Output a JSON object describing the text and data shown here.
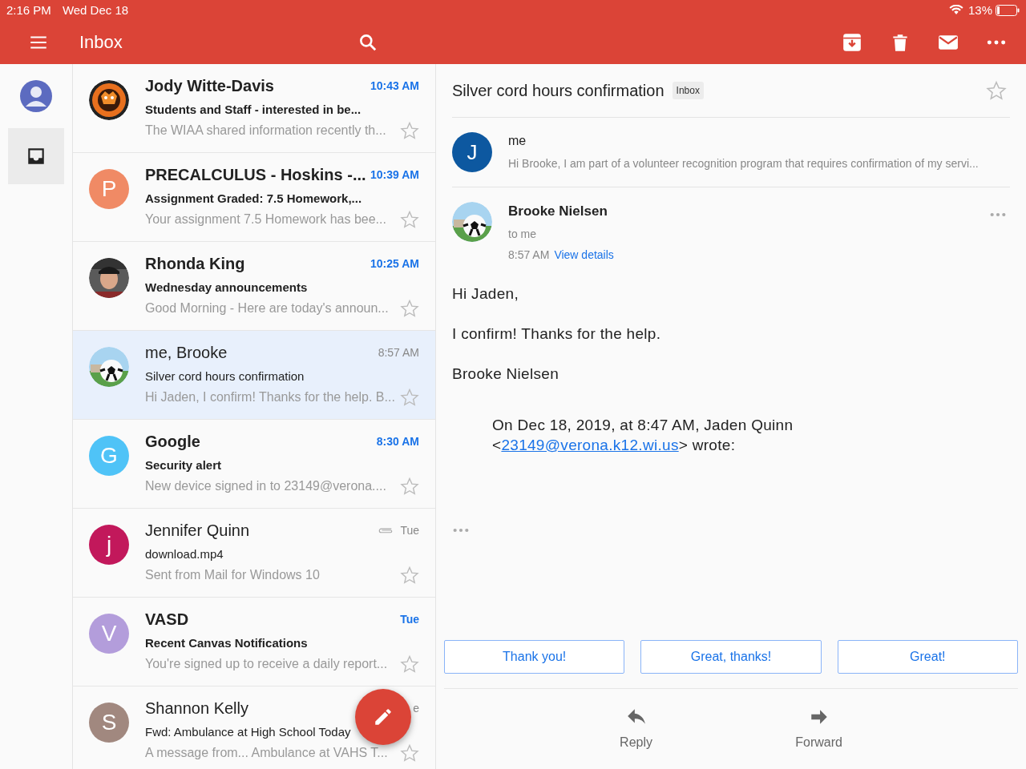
{
  "status_bar": {
    "time": "2:16 PM",
    "date": "Wed Dec 18",
    "battery": "13%"
  },
  "toolbar": {
    "title": "Inbox"
  },
  "rail": [
    {
      "kind": "account",
      "selected": false
    },
    {
      "kind": "inbox",
      "selected": true
    }
  ],
  "messages": [
    {
      "sender": "Jody Witte-Davis",
      "subject": "Students and Staff - interested in be...",
      "snippet": "The WIAA shared information recently th...",
      "time": "10:43 AM",
      "unread": true,
      "selected": false,
      "attachment": false
    },
    {
      "sender": "PRECALCULUS - Hoskins -...",
      "subject": "Assignment Graded: 7.5 Homework,...",
      "snippet": "Your assignment 7.5 Homework has bee...",
      "time": "10:39 AM",
      "unread": true,
      "selected": false,
      "attachment": false,
      "avatar": {
        "kind": "letter",
        "letter": "P",
        "color": "#f08a65"
      }
    },
    {
      "sender": "Rhonda King",
      "subject": "Wednesday announcements",
      "snippet": "Good Morning - Here are today's announ...",
      "time": "10:25 AM",
      "unread": true,
      "selected": false,
      "attachment": false
    },
    {
      "sender": "me, Brooke",
      "subject": "Silver cord hours confirmation",
      "snippet": "Hi Jaden, I confirm! Thanks for the help. B...",
      "time": "8:57 AM",
      "unread": false,
      "selected": true,
      "attachment": false
    },
    {
      "sender": "Google",
      "subject": "Security alert",
      "snippet": "New device signed in to 23149@verona....",
      "time": "8:30 AM",
      "unread": true,
      "selected": false,
      "attachment": false,
      "avatar": {
        "kind": "letter",
        "letter": "G",
        "color": "#4fc3f7"
      }
    },
    {
      "sender": "Jennifer Quinn",
      "subject": "download.mp4",
      "snippet": "Sent from Mail for Windows 10",
      "time": "Tue",
      "unread": false,
      "selected": false,
      "attachment": true,
      "avatar": {
        "kind": "letter",
        "letter": "j",
        "color": "#c2185b"
      }
    },
    {
      "sender": "VASD",
      "subject": "Recent Canvas Notifications",
      "snippet": "You're signed up to receive a daily report...",
      "time": "Tue",
      "unread": true,
      "selected": false,
      "attachment": false,
      "avatar": {
        "kind": "letter",
        "letter": "V",
        "color": "#b39ddb"
      }
    },
    {
      "sender": "Shannon Kelly",
      "subject": "Fwd: Ambulance at High School Today",
      "snippet": "A message from... Ambulance at VAHS T...",
      "time": "e",
      "unread": false,
      "selected": false,
      "attachment": false,
      "avatar": {
        "kind": "letter",
        "letter": "S",
        "color": "#a1887f"
      }
    }
  ],
  "conversation": {
    "subject": "Silver cord hours confirmation",
    "label": "Inbox",
    "starred": false,
    "collapsed": {
      "sender": "me",
      "avatar_letter": "J",
      "snippet": "Hi Brooke, I am part of a volunteer recognition program that requires confirmation of my servi..."
    },
    "open": {
      "sender": "Brooke Nielsen",
      "to": "to me",
      "time": "8:57 AM",
      "details_link": "View details",
      "body": [
        "Hi Jaden,",
        "I confirm! Thanks for the help.",
        "Brooke Nielsen"
      ],
      "quote": {
        "line1": "On Dec 18, 2019, at 8:47 AM, Jaden Quinn",
        "before": "<",
        "email": "23149@verona.k12.wi.us",
        "after": "> wrote:"
      }
    },
    "smart_replies": [
      "Thank you!",
      "Great, thanks!",
      "Great!"
    ],
    "actions": [
      {
        "kind": "reply",
        "label": "Reply"
      },
      {
        "kind": "forward",
        "label": "Forward"
      }
    ]
  }
}
